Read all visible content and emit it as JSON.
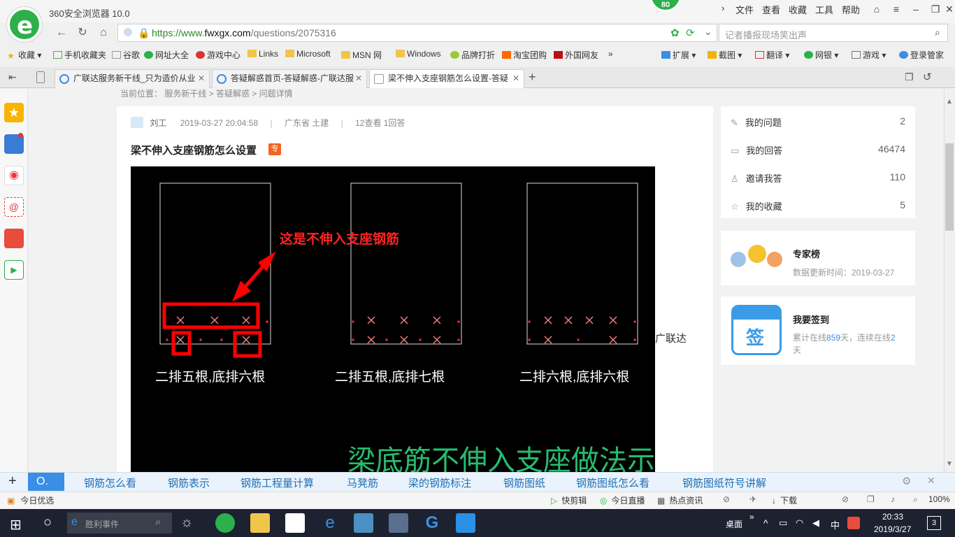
{
  "app": {
    "title": "360安全浏览器 10.0",
    "badge": "80"
  },
  "menu": [
    "文件",
    "查看",
    "收藏",
    "工具",
    "帮助"
  ],
  "address": {
    "protocol": "https://www.",
    "host": "fwxgx.com",
    "path": "/questions/2075316",
    "search_placeholder": "记者播报现场笑出声"
  },
  "bookmarks": [
    "收藏",
    "手机收藏夹",
    "谷歌",
    "网址大全",
    "游戏中心",
    "Links",
    "Microsoft",
    "MSN 网",
    "Windows",
    "品牌打折",
    "淘宝团购",
    "外国网友"
  ],
  "tools": [
    "扩展",
    "截图",
    "翻译",
    "网银",
    "游戏",
    "登录管家"
  ],
  "tabs": [
    {
      "label": "广联达服务新干线_只为造价从业"
    },
    {
      "label": "答疑解惑首页-答疑解惑-广联达服"
    },
    {
      "label": "梁不伸入支座钢筋怎么设置-答疑"
    }
  ],
  "page": {
    "breadcrumb": "当前位置： 服务新干线 > 答疑解惑 > 问题详情",
    "author": "刘工",
    "datetime": "2019-03-27 20:04:58",
    "region": "广东省  土建",
    "stats": "12查看  1回答",
    "title": "梁不伸入支座钢筋怎么设置",
    "tag": "专",
    "side_text": "广联达",
    "cad": {
      "annotation": "这是不伸入支座钢筋",
      "caption1": "二排五根,底排六根",
      "caption2": "二排五根,底排七根",
      "caption3": "二排六根,底排六根",
      "bottom_text": "梁底筋不伸入支座做法示意"
    }
  },
  "right": {
    "items": [
      {
        "label": "我的问题",
        "count": "2"
      },
      {
        "label": "我的回答",
        "count": "46474"
      },
      {
        "label": "邀请我答",
        "count": "110"
      },
      {
        "label": "我的收藏",
        "count": "5"
      }
    ],
    "experts": {
      "title": "专家榜",
      "update": "数据更新时间：2019-03-27"
    },
    "signin": {
      "title": "我要签到",
      "icon": "签",
      "line1": "累计在线",
      "days_total": "859",
      "line2": "天，连续在线",
      "days_cont": "2",
      "line3": "天"
    }
  },
  "hot": [
    "钢筋怎么看",
    "钢筋表示",
    "钢筋工程量计算",
    "马凳筋",
    "梁的钢筋标注",
    "钢筋图纸",
    "钢筋图纸怎么看",
    "钢筋图纸符号讲解"
  ],
  "status": {
    "left": "今日优选",
    "items": [
      "快剪辑",
      "今日直播",
      "热点资讯",
      "下载"
    ],
    "zoom": "100%"
  },
  "taskbar": {
    "search": "胜利事件",
    "desktop": "桌面",
    "ime": "中",
    "time": "20:33",
    "date": "2019/3/27",
    "notif": "3"
  }
}
